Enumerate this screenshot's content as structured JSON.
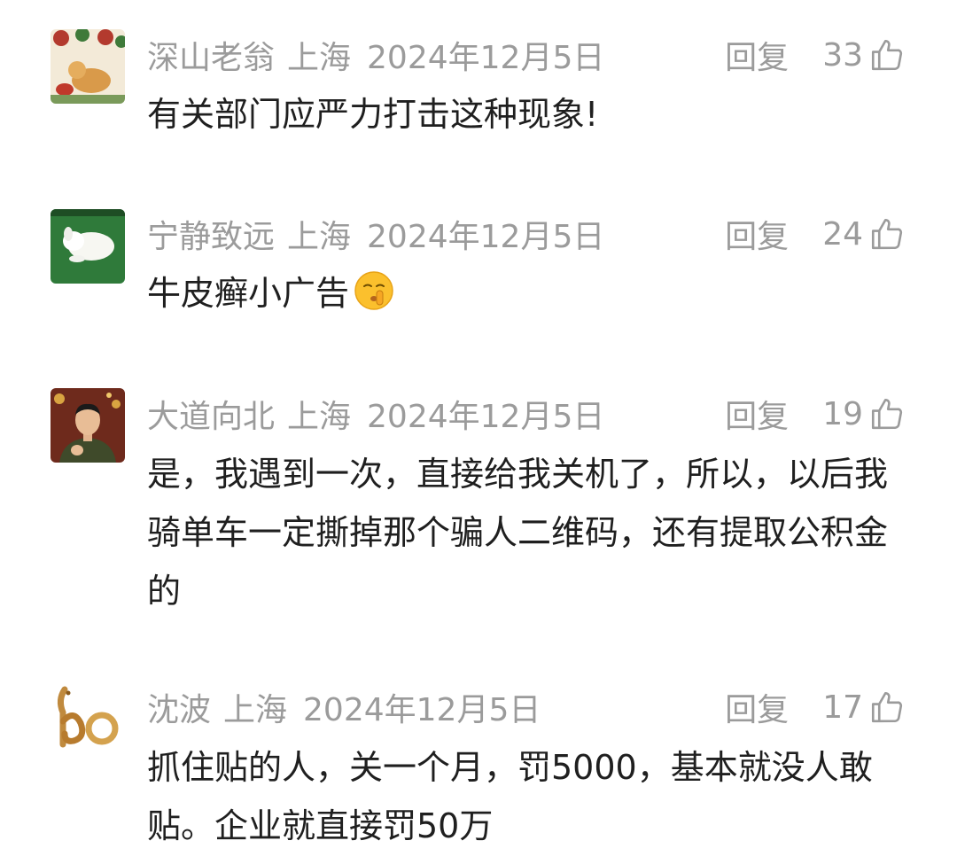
{
  "comments": [
    {
      "name": "深山老翁",
      "location": "上海",
      "date": "2024年12月5日",
      "reply": "回复",
      "likes": "33",
      "text": "有关部门应严力打击这种现象!",
      "avatar_icon": "christmas-dog-avatar"
    },
    {
      "name": "宁静致远",
      "location": "上海",
      "date": "2024年12月5日",
      "reply": "回复",
      "likes": "24",
      "text": "牛皮癣小广告",
      "avatar_icon": "sleeping-puppy-avatar",
      "emoji": "shushing-face-emoji"
    },
    {
      "name": "大道向北",
      "location": "上海",
      "date": "2024年12月5日",
      "reply": "回复",
      "likes": "19",
      "text": "是，我遇到一次，直接给我关机了，所以，以后我骑单车一定撕掉那个骗人二维码，还有提取公积金的",
      "avatar_icon": "man-portrait-avatar"
    },
    {
      "name": "沈波",
      "location": "上海",
      "date": "2024年12月5日",
      "reply": "回复",
      "likes": "17",
      "text": "抓住贴的人，关一个月，罚5000，基本就没人敢贴。企业就直接罚50万",
      "avatar_icon": "gold-logo-avatar"
    }
  ],
  "colors": {
    "meta": "#9b9b9b",
    "body": "#1f1f1f"
  }
}
